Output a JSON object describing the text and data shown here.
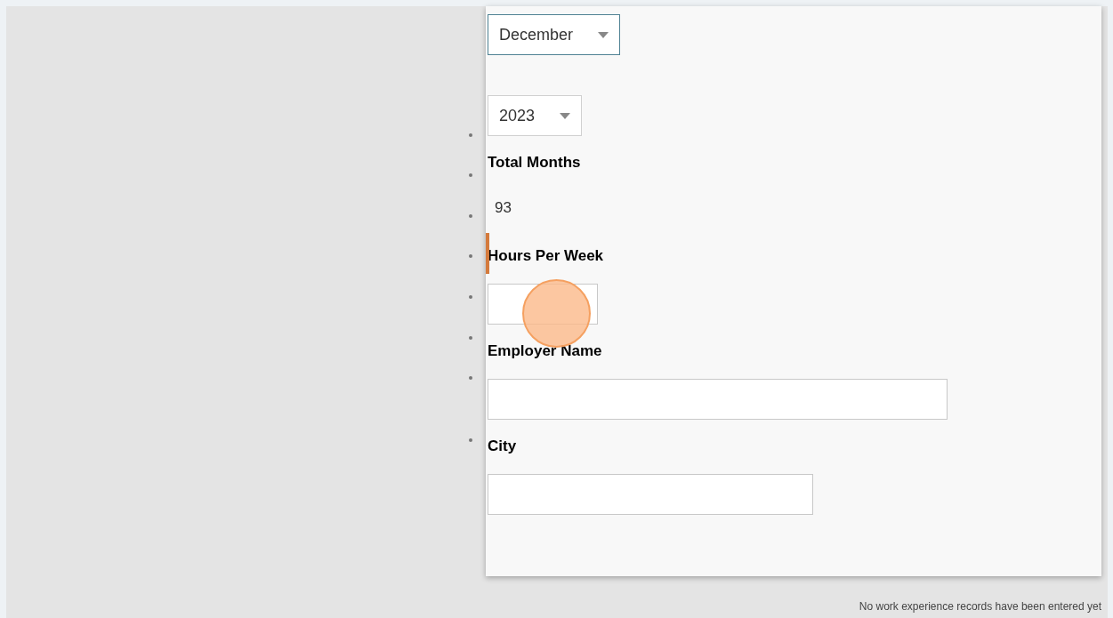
{
  "dialog": {
    "fields": [
      {
        "kind": "select",
        "value": "December",
        "focused": true
      },
      {
        "kind": "select",
        "value": "2023",
        "focused": false
      },
      {
        "kind": "readonly",
        "label": "Total Months",
        "value": "93"
      },
      {
        "kind": "input",
        "label": "Hours Per Week"
      },
      {
        "kind": "input",
        "label": "Employer Name"
      },
      {
        "kind": "input",
        "label": "City"
      }
    ]
  },
  "footer": {
    "message": "No work experience records have been entered yet"
  }
}
